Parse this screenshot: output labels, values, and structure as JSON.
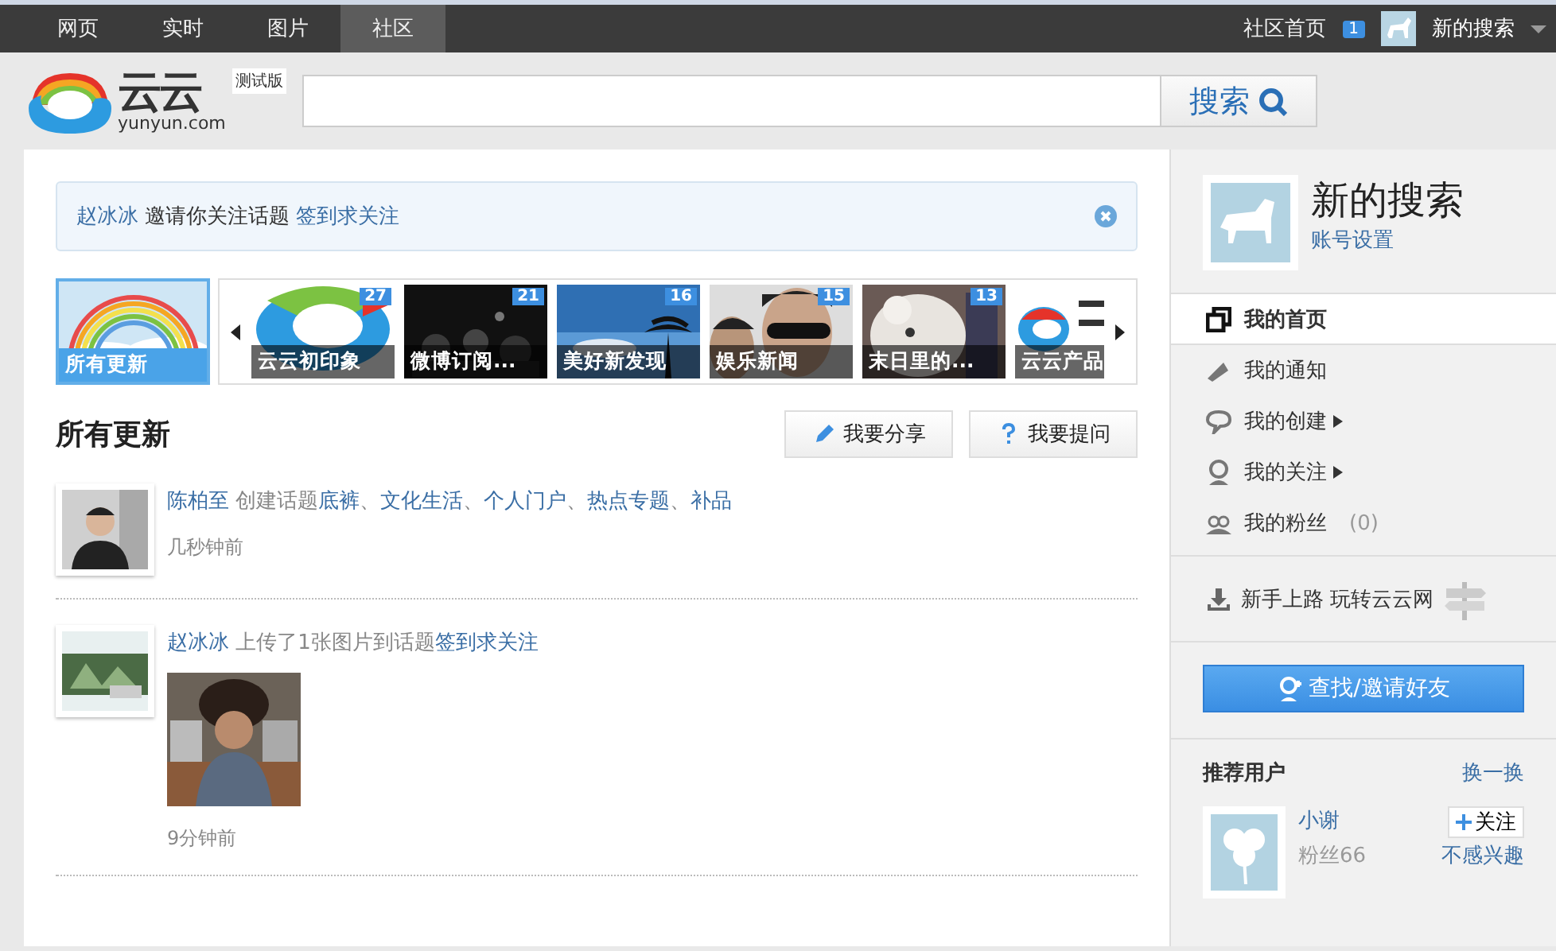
{
  "nav": {
    "tabs": [
      {
        "label": "网页",
        "selected": false
      },
      {
        "label": "实时",
        "selected": false
      },
      {
        "label": "图片",
        "selected": false
      },
      {
        "label": "社区",
        "selected": true
      }
    ],
    "home_link": "社区首页",
    "home_badge": "1",
    "user_name": "新的搜索"
  },
  "header": {
    "logo_text": "云云",
    "logo_domain": "yunyun.com",
    "beta_tag": "测试版",
    "search_button": "搜索"
  },
  "notice": {
    "user": "赵冰冰",
    "text": "邀请你关注话题",
    "topic": "签到求关注"
  },
  "topics": [
    {
      "label": "所有更新",
      "selected": true
    },
    {
      "label": "云云初印象",
      "badge": "27",
      "selected": false
    },
    {
      "label": "微博订阅...",
      "badge": "21",
      "selected": false
    },
    {
      "label": "美好新发现",
      "badge": "16",
      "selected": false
    },
    {
      "label": "娱乐新闻",
      "badge": "15",
      "selected": false
    },
    {
      "label": "末日里的...",
      "badge": "13",
      "selected": false
    },
    {
      "label": "云云产品",
      "selected": false
    }
  ],
  "feed": {
    "title": "所有更新",
    "buttons": [
      "我要分享",
      "我要提问"
    ],
    "items": [
      {
        "user": "陈柏至",
        "action": "创建话题",
        "separator": "、",
        "topics": [
          "底裤",
          "文化生活",
          "个人门户",
          "热点专题",
          "补品"
        ],
        "time": "几秒钟前"
      },
      {
        "user": "赵冰冰",
        "action": "上传了1张图片到话题",
        "topics": [
          "签到求关注"
        ],
        "photo": {
          "kind": "picture"
        },
        "time": "9分钟前"
      }
    ]
  },
  "profile": {
    "name": "新的搜索",
    "settings_link": "账号设置"
  },
  "menu": [
    {
      "label": "我的首页",
      "selected": true,
      "expandable": false
    },
    {
      "label": "我的通知",
      "selected": false,
      "expandable": false
    },
    {
      "label": "我的创建",
      "selected": false,
      "expandable": true
    },
    {
      "label": "我的关注",
      "selected": false,
      "expandable": true
    },
    {
      "label": "我的粉丝",
      "count": "(0)",
      "selected": false,
      "expandable": false
    }
  ],
  "guide": "新手上路 玩转云云网",
  "invite_button": "查找/邀请好友",
  "recommend": {
    "title": "推荐用户",
    "refresh": "换一换",
    "users": [
      {
        "name": "小谢",
        "fans": "粉丝66",
        "follow": "关注",
        "dismiss": "不感兴趣"
      }
    ]
  }
}
